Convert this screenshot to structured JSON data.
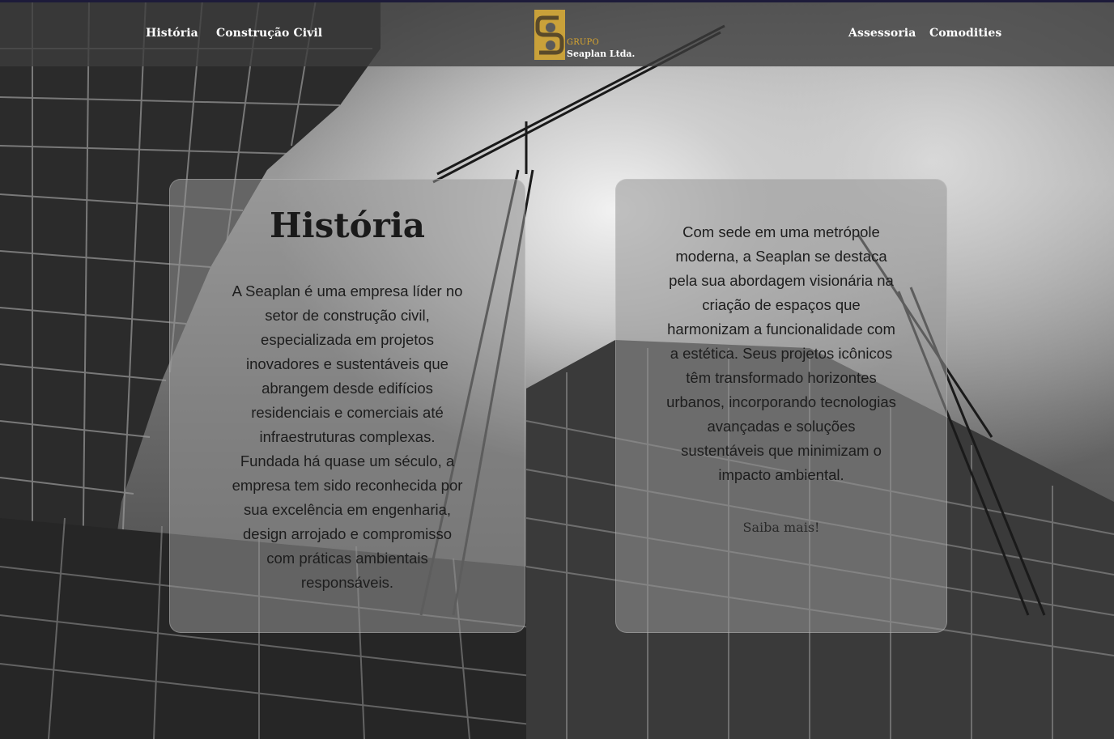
{
  "header": {
    "nav_left": [
      "História",
      "Construção Civil"
    ],
    "nav_right": [
      "Assessoria",
      "Comodities"
    ],
    "logo": {
      "line1": "GRUPO",
      "line2": "Seaplan Ltda."
    }
  },
  "cards": {
    "history": {
      "title": "História",
      "text": "A Seaplan é uma empresa líder no setor de construção civil, especializada em projetos inovadores e sustentáveis que abrangem desde edifícios residenciais e comerciais até infraestruturas complexas. Fundada há quase um século, a empresa tem sido reconhecida por sua excelência em engenharia, design arrojado e compromisso com práticas ambientais responsáveis."
    },
    "about": {
      "text": "Com sede em uma metrópole moderna, a Seaplan se destaca pela sua abordagem visionária na criação de espaços que harmonizam a funcionalidade com a estética. Seus projetos icônicos têm transformado horizontes urbanos, incorporando tecnologias avançadas e soluções sustentáveis que minimizam o impacto ambiental.",
      "link": "Saiba mais!"
    }
  },
  "colors": {
    "logo_gold": "#c9a13a",
    "header_bg": "#3c3c3c",
    "top_line": "#1d1b3a"
  },
  "icons": {
    "logo": "seaplan-s-logo-icon"
  }
}
